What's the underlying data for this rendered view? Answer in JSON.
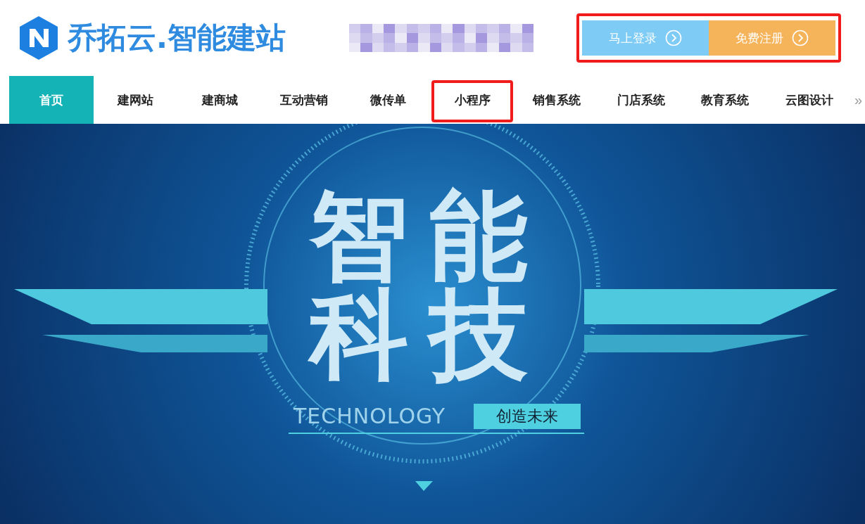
{
  "header": {
    "logo_text": "乔拓云.智能建站",
    "buttons": [
      {
        "label": "马上登录",
        "color": "#7ecbf5"
      },
      {
        "label": "免费注册",
        "color": "#f5b35a"
      }
    ],
    "buttons_highlighted": true
  },
  "nav": {
    "items": [
      {
        "label": "首页",
        "selected": true,
        "highlighted": false
      },
      {
        "label": "建网站",
        "selected": false,
        "highlighted": false
      },
      {
        "label": "建商城",
        "selected": false,
        "highlighted": false
      },
      {
        "label": "互动营销",
        "selected": false,
        "highlighted": false
      },
      {
        "label": "微传单",
        "selected": false,
        "highlighted": false
      },
      {
        "label": "小程序",
        "selected": false,
        "highlighted": true
      },
      {
        "label": "销售系统",
        "selected": false,
        "highlighted": false
      },
      {
        "label": "门店系统",
        "selected": false,
        "highlighted": false
      },
      {
        "label": "教育系统",
        "selected": false,
        "highlighted": false
      },
      {
        "label": "云图设计",
        "selected": false,
        "highlighted": false
      }
    ],
    "more": "»"
  },
  "banner": {
    "headline_top": "智能",
    "headline_bottom": "科技",
    "subtitle": "TECHNOLOGY",
    "tag": "创造未来"
  }
}
